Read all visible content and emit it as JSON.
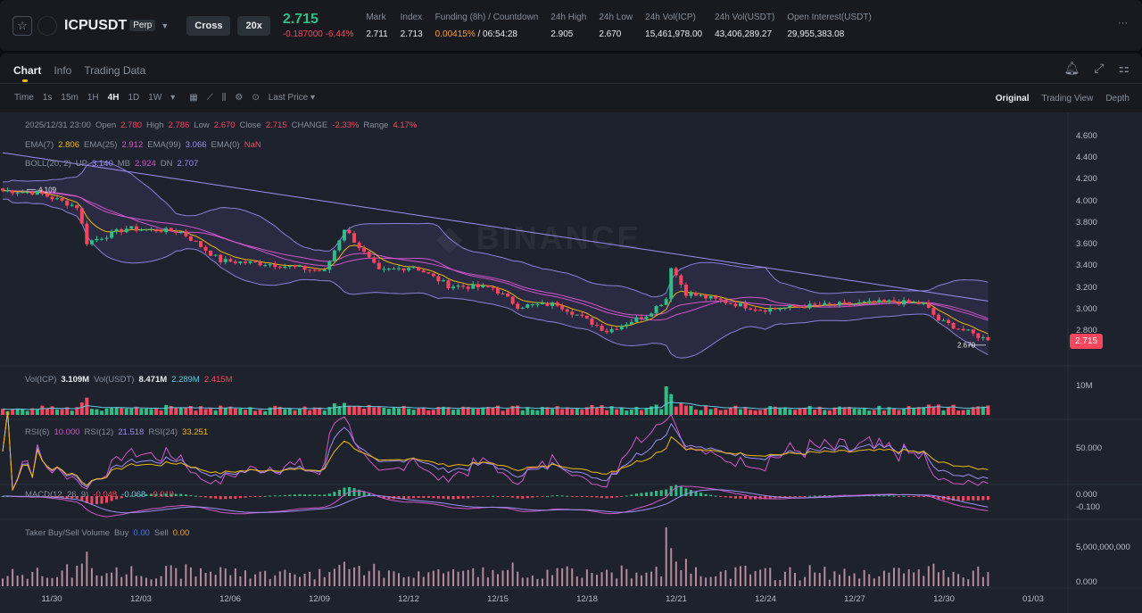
{
  "header": {
    "symbol": "ICPUSDT",
    "type": "Perp",
    "margin": "Cross",
    "leverage": "20x",
    "price": "2.715",
    "change": "-0.187000 -6.44%",
    "stats": [
      {
        "label": "Mark",
        "value": "2.711"
      },
      {
        "label": "Index",
        "value": "2.713"
      },
      {
        "label": "Funding (8h) / Countdown",
        "value": "0.00415%",
        "value2": " / 06:54:28"
      },
      {
        "label": "24h High",
        "value": "2.905"
      },
      {
        "label": "24h Low",
        "value": "2.670"
      },
      {
        "label": "24h Vol(ICP)",
        "value": "15,461,978.00"
      },
      {
        "label": "24h Vol(USDT)",
        "value": "43,406,289.27"
      },
      {
        "label": "Open Interest(USDT)",
        "value": "29,955,383.08"
      }
    ],
    "more": "···"
  },
  "tabs": [
    "Chart",
    "Info",
    "Trading Data"
  ],
  "toolbar": {
    "intervals": [
      "Time",
      "1s",
      "15m",
      "1H",
      "4H",
      "1D",
      "1W"
    ],
    "active": "4H",
    "price_type": "Last Price",
    "views": [
      "Original",
      "Trading View",
      "Depth"
    ]
  },
  "legend": {
    "ohlc": {
      "date": "2025/12/31 23:00",
      "open_l": "Open",
      "open": "2.780",
      "high_l": "High",
      "high": "2.786",
      "low_l": "Low",
      "low": "2.670",
      "close_l": "Close",
      "close": "2.715",
      "change_l": "CHANGE",
      "change": "-2.33%",
      "range_l": "Range",
      "range": "4.17%"
    },
    "ema": {
      "l7": "EMA(7)",
      "v7": "2.806",
      "l25": "EMA(25)",
      "v25": "2.912",
      "l99": "EMA(99)",
      "v99": "3.066",
      "l0": "EMA(0)",
      "v0": "NaN"
    },
    "boll": {
      "l": "BOLL(20, 2)",
      "up_l": "UP",
      "up": "3.140",
      "mb_l": "MB",
      "mb": "2.924",
      "dn_l": "DN",
      "dn": "2.707"
    },
    "vol": {
      "l1": "Vol(ICP)",
      "v1": "3.109M",
      "l2": "Vol(USDT)",
      "v2": "8.471M",
      "v3": "2.289M",
      "v4": "2.415M"
    },
    "rsi": {
      "l6": "RSI(6)",
      "v6": "10.000",
      "l12": "RSI(12)",
      "v12": "21.518",
      "l24": "RSI(24)",
      "v24": "33.251"
    },
    "macd": {
      "l": "MACD(12, 26, 9)",
      "v1": "-0.048",
      "v2": "-0.068",
      "v3": "-0.019"
    },
    "taker": {
      "l": "Taker Buy/Sell Volume",
      "buy_l": "Buy",
      "buy": "0.00",
      "sell_l": "Sell",
      "sell": "0.00"
    }
  },
  "watermark": "BINANCE",
  "chart_data": {
    "type": "candlestick",
    "title": "ICPUSDT Perp 4H",
    "price_axis": [
      "4.600",
      "4.400",
      "4.200",
      "4.000",
      "3.800",
      "3.600",
      "3.400",
      "3.200",
      "3.000",
      "2.800"
    ],
    "ylim": [
      2.8,
      4.6
    ],
    "vol_axis": [
      "10M"
    ],
    "rsi_axis": [
      "50.000"
    ],
    "macd_axis": [
      "0.000",
      "-0.100"
    ],
    "taker_axis": [
      "5,000,000,000",
      "0.000"
    ],
    "dates": [
      "11/30",
      "12/03",
      "12/06",
      "12/09",
      "12/12",
      "12/15",
      "12/18",
      "12/21",
      "12/24",
      "12/27",
      "12/30",
      "01/03"
    ],
    "high_mark": "4.109",
    "low_mark": "2.670",
    "last_price": "2.715",
    "close_keypoints": [
      [
        0,
        4.1
      ],
      [
        7,
        4.08
      ],
      [
        15,
        3.95
      ],
      [
        17,
        3.62
      ],
      [
        25,
        3.75
      ],
      [
        36,
        3.72
      ],
      [
        44,
        3.45
      ],
      [
        54,
        3.42
      ],
      [
        65,
        3.35
      ],
      [
        69,
        3.75
      ],
      [
        76,
        3.35
      ],
      [
        83,
        3.4
      ],
      [
        90,
        3.22
      ],
      [
        99,
        3.2
      ],
      [
        104,
        3.03
      ],
      [
        112,
        3.05
      ],
      [
        122,
        2.8
      ],
      [
        130,
        2.95
      ],
      [
        134,
        3.1
      ],
      [
        135,
        3.4
      ],
      [
        138,
        3.15
      ],
      [
        153,
        3.0
      ],
      [
        162,
        3.03
      ],
      [
        180,
        3.07
      ],
      [
        186,
        3.05
      ],
      [
        189,
        2.9
      ],
      [
        199,
        2.715
      ]
    ]
  }
}
